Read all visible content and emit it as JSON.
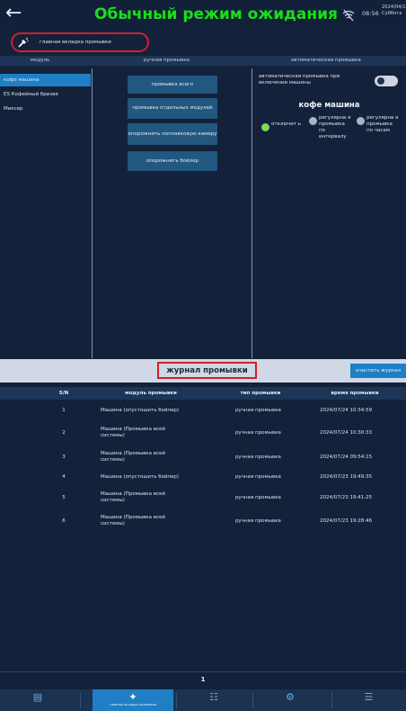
{
  "header": {
    "back_icon": "arrow-left-icon",
    "title": "Обычный режим ожидания",
    "status_icon": "wifi-off-icon",
    "time": "08:56",
    "date_line1": "2024/04/1",
    "date_line2": "Суббота"
  },
  "tab_chip": {
    "icon": "cleaning-brush-icon",
    "label": "главная вкладка промывки"
  },
  "columns": {
    "module": "модуль",
    "manual": "ручная промывка",
    "auto": "автоматическая промывка"
  },
  "modules": [
    "кофе машина",
    "ES Кофейный бризве",
    "Миксер"
  ],
  "manual_buttons": [
    "промывка всего",
    "промывка отдельных модулей",
    "опорожнить поплавковую камеру",
    "опорожнить бойлер"
  ],
  "auto": {
    "startup_label": "автоматическая промывка при включении машины",
    "toggle_on": false,
    "machine_title": "кофе машина",
    "options": [
      "отключит ь",
      "регулярна я промывка по интервалу",
      "регулярна я промывка по часам"
    ],
    "selected_index": 0
  },
  "log": {
    "title": "журнал промывки",
    "clear_label": "очистить журнал",
    "headers": [
      "S/N",
      "модуль промывки",
      "тип промывки",
      "время промывки"
    ],
    "rows": [
      [
        "1",
        "Машина (опустошить бойлер)",
        "ручная промывка",
        "2024/07/24 10:34:59"
      ],
      [
        "2",
        "Машина (Промывка всей системы)",
        "ручная промывка",
        "2024/07/24 10:30:33"
      ],
      [
        "3",
        "Машина (Промывка всей системы)",
        "ручная промывка",
        "2024/07/24 09:54:15"
      ],
      [
        "4",
        "Машина (опустошить бойлер)",
        "ручная промывка",
        "2024/07/23 19:49:35"
      ],
      [
        "5",
        "Машина (Промывка всей системы)",
        "ручная промывка",
        "2024/07/23 19:41:25"
      ],
      [
        "6",
        "Машина (Промывка всей системы)",
        "ручная промывка",
        "2024/07/23 19:28:46"
      ]
    ],
    "page": "1"
  },
  "nav": [
    {
      "icon": "monitor-icon",
      "label": ""
    },
    {
      "icon": "cleaning-brush-icon",
      "label": "главная вкладка промывки"
    },
    {
      "icon": "tree-structure-icon",
      "label": ""
    },
    {
      "icon": "settings-icon",
      "label": ""
    },
    {
      "icon": "list-icon",
      "label": ""
    }
  ],
  "colors": {
    "background": "#13213a",
    "title_green": "#19e019",
    "accent_blue": "#1f7fc4",
    "highlight_red": "#d11f2f"
  }
}
